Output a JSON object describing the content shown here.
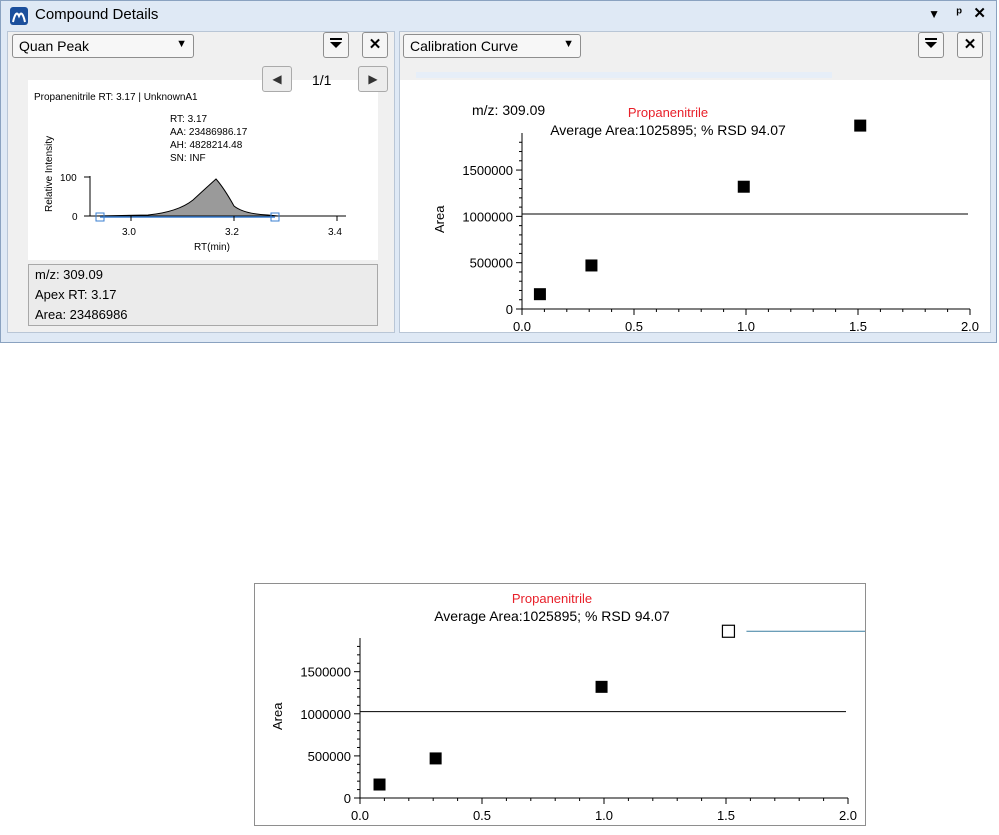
{
  "window": {
    "title": "Compound Details",
    "controls": "▾ ₱ ✕"
  },
  "left_pane": {
    "view_selector": "Quan Peak",
    "pager": "1/1",
    "peak_header": "Propanenitrile  RT: 3.17 | UnknownA1",
    "annotations": [
      "RT: 3.17",
      "AA: 23486986.17",
      "AH: 4828214.48",
      "SN: INF"
    ],
    "y_axis_label": "Relative Intensity",
    "x_axis_label": "RT(min)",
    "y_ticks": [
      "100",
      "0"
    ],
    "x_ticks": [
      "3.0",
      "3.2",
      "3.4"
    ],
    "info": {
      "mz": "m/z: 309.09",
      "apex_rt": "Apex RT: 3.17",
      "area": "Area: 23486986"
    }
  },
  "right_pane": {
    "view_selector": "Calibration Curve",
    "mz_label": "m/z: 309.09",
    "compound": "Propanenitrile",
    "subtitle": "Average Area:1025895; % RSD 94.07",
    "y_axis_label": "Area",
    "x_ticks": [
      "0.0",
      "0.5",
      "1.0",
      "1.5",
      "2.0"
    ],
    "y_ticks": [
      "0",
      "500000",
      "1000000",
      "1500000"
    ]
  },
  "colors": {
    "compound_title": "#e8202a",
    "window_frame": "#dfe9f5",
    "callout_line": "#3a7fa0"
  },
  "chart_data": [
    {
      "type": "scatter",
      "title": "Propanenitrile",
      "subtitle": "Average Area:1025895; % RSD 94.07",
      "ylabel": "Area",
      "xlim": [
        0,
        2.0
      ],
      "ylim": [
        0,
        1900000
      ],
      "x_ticks": [
        "0.0",
        "0.5",
        "1.0",
        "1.5",
        "2.0"
      ],
      "y_ticks": [
        "0",
        "500000",
        "1000000",
        "1500000"
      ],
      "average_line": 1025895,
      "points": [
        {
          "x": 0.08,
          "y": 160000
        },
        {
          "x": 0.31,
          "y": 470000
        },
        {
          "x": 0.99,
          "y": 1320000
        },
        {
          "x": 1.51,
          "y": 1980000
        }
      ]
    },
    {
      "type": "scatter",
      "title": "Propanenitrile",
      "subtitle": "Average Area:1025895; % RSD 94.07",
      "ylabel": "Area",
      "xlim": [
        0,
        2.0
      ],
      "ylim": [
        0,
        1900000
      ],
      "x_ticks": [
        "0.0",
        "0.5",
        "1.0",
        "1.5",
        "2.0"
      ],
      "y_ticks": [
        "0",
        "500000",
        "1000000",
        "1500000"
      ],
      "average_line": 1025895,
      "points": [
        {
          "x": 0.08,
          "y": 160000
        },
        {
          "x": 0.31,
          "y": 470000
        },
        {
          "x": 0.99,
          "y": 1320000
        },
        {
          "x": 1.51,
          "y": 1980000,
          "excluded": true
        }
      ]
    }
  ]
}
